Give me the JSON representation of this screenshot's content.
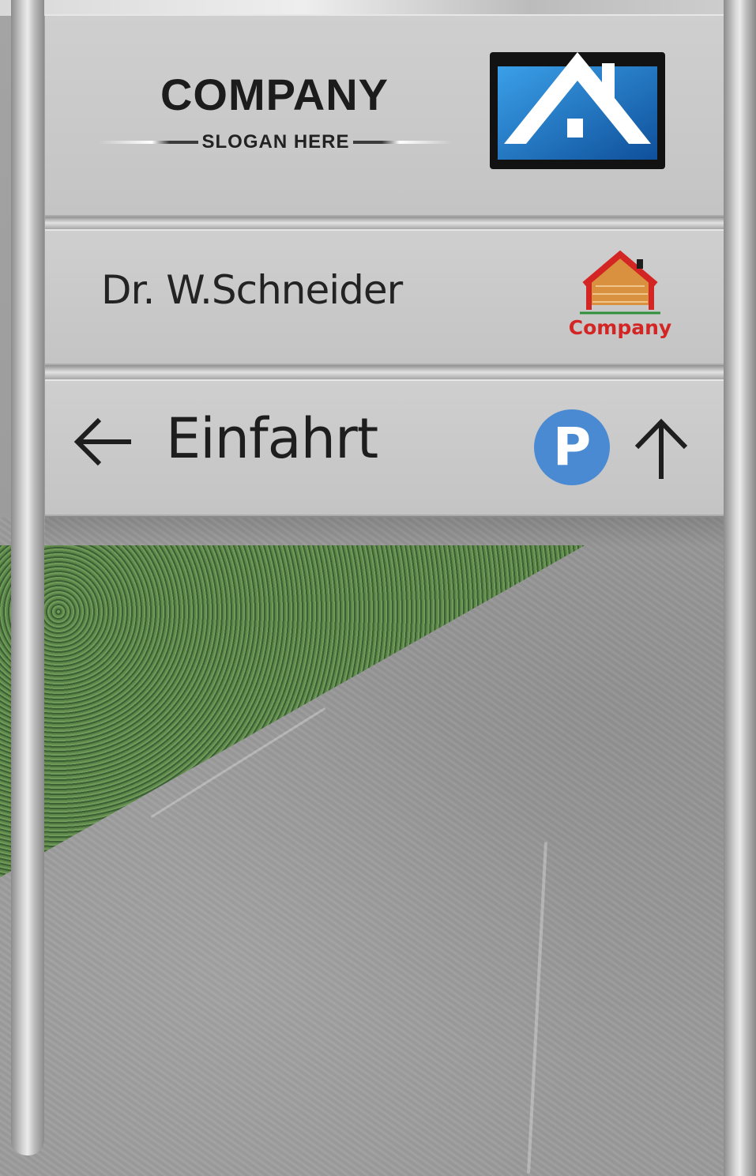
{
  "sign": {
    "company_name": "COMPANY",
    "slogan": "SLOGAN HERE",
    "person_name": "Dr. W.Schneider",
    "brick_logo_label": "Company",
    "direction_label": "Einfahrt",
    "parking_symbol": "P"
  },
  "icons": {
    "house_logo": "house-logo-icon",
    "brick_house_logo": "brick-house-icon",
    "left_arrow": "arrow-left-icon",
    "parking": "parking-icon",
    "up_arrow": "arrow-up-icon"
  },
  "colors": {
    "panel": "#c9c9c9",
    "text": "#1e1e1e",
    "logo_blue": "#1e6fc0",
    "parking_blue": "#4a8ad3",
    "brand_red": "#d42525",
    "grass": "#4d7440"
  }
}
